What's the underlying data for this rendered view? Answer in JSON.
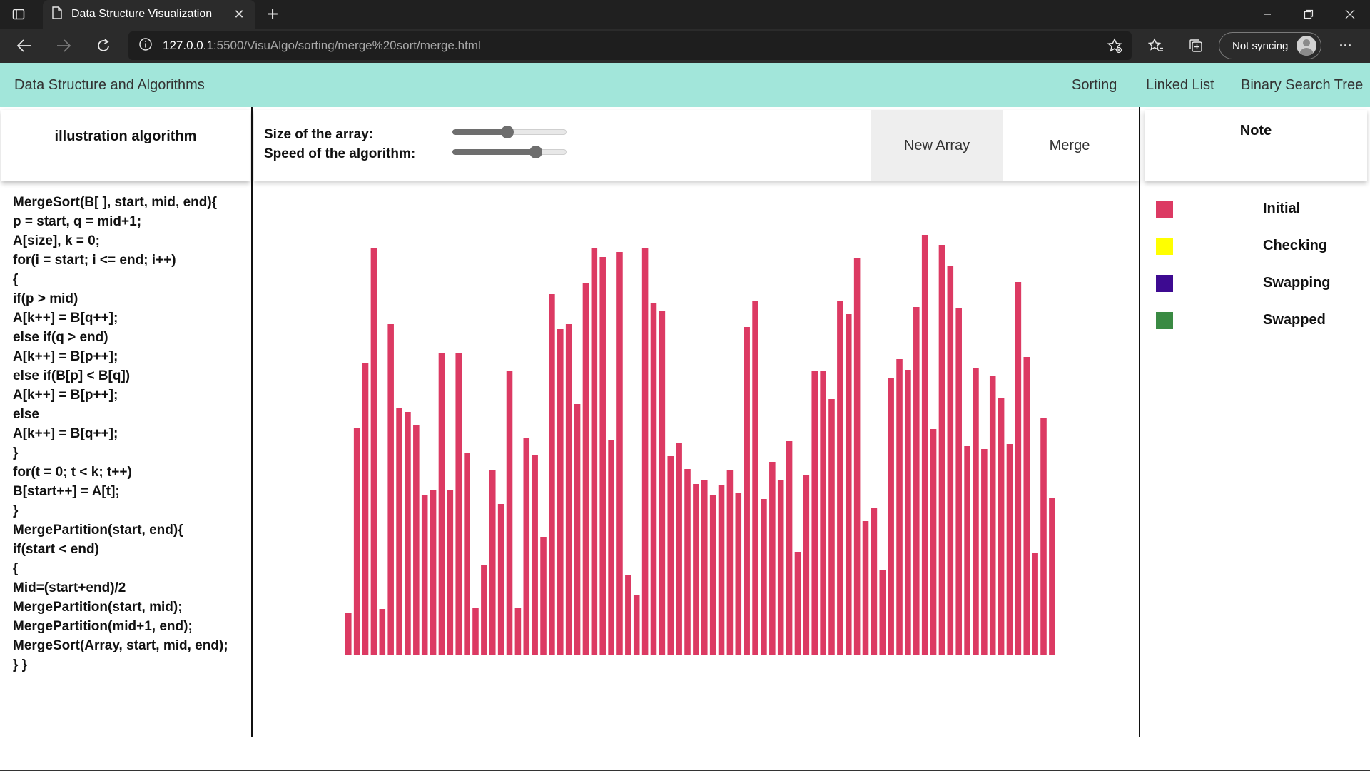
{
  "browser": {
    "tab_title": "Data Structure Visualization",
    "url_host": "127.0.0.1",
    "url_path": ":5500/VisuAlgo/sorting/merge%20sort/merge.html",
    "sync_label": "Not syncing",
    "more_label": "···"
  },
  "navbar": {
    "brand": "Data Structure and Algorithms",
    "links": [
      "Sorting",
      "Linked List",
      "Binary Search Tree"
    ]
  },
  "left": {
    "title": "illustration algorithm",
    "code": "MergeSort(B[ ], start, mid, end){\np = start, q = mid+1;\nA[size], k = 0;\nfor(i = start; i <= end; i++)\n{\nif(p > mid)\nA[k++] = B[q++];\nelse if(q > end)\nA[k++] = B[p++];\nelse if(B[p] < B[q])\nA[k++] = B[p++];\nelse\nA[k++] = B[q++];\n}\nfor(t = 0; t < k; t++)\nB[start++] = A[t];\n}\nMergePartition(start, end){\nif(start < end)\n{\nMid=(start+end)/2\nMergePartition(start, mid);\nMergePartition(mid+1, end);\nMergeSort(Array, start, mid, end);\n} }"
  },
  "controls": {
    "size_label": "Size of the array:",
    "speed_label": "Speed of the algorithm:",
    "size_value": 0.48,
    "speed_value": 0.73,
    "new_array_label": "New Array",
    "merge_label": "Merge"
  },
  "note": {
    "title": "Note",
    "legend": [
      {
        "label": "Initial",
        "color": "#dc3a63"
      },
      {
        "label": "Checking",
        "color": "#ffff00"
      },
      {
        "label": "Swapping",
        "color": "#3d0a91"
      },
      {
        "label": "Swapped",
        "color": "#3a8a43"
      }
    ]
  },
  "bars": {
    "color": "#dc3a63",
    "values": [
      59,
      318,
      410,
      570,
      65,
      464,
      346,
      341,
      323,
      225,
      232,
      423,
      231,
      423,
      283,
      67,
      126,
      259,
      212,
      399,
      66,
      305,
      281,
      166,
      506,
      457,
      464,
      352,
      522,
      570,
      558,
      301,
      565,
      113,
      85,
      570,
      493,
      483,
      279,
      297,
      261,
      240,
      245,
      225,
      238,
      259,
      227,
      460,
      497,
      219,
      271,
      246,
      300,
      145,
      253,
      398,
      398,
      359,
      496,
      478,
      556,
      188,
      207,
      119,
      388,
      415,
      400,
      488,
      589,
      317,
      575,
      546,
      487,
      293,
      403,
      289,
      391,
      361,
      296,
      523,
      418,
      143,
      333,
      221
    ]
  }
}
